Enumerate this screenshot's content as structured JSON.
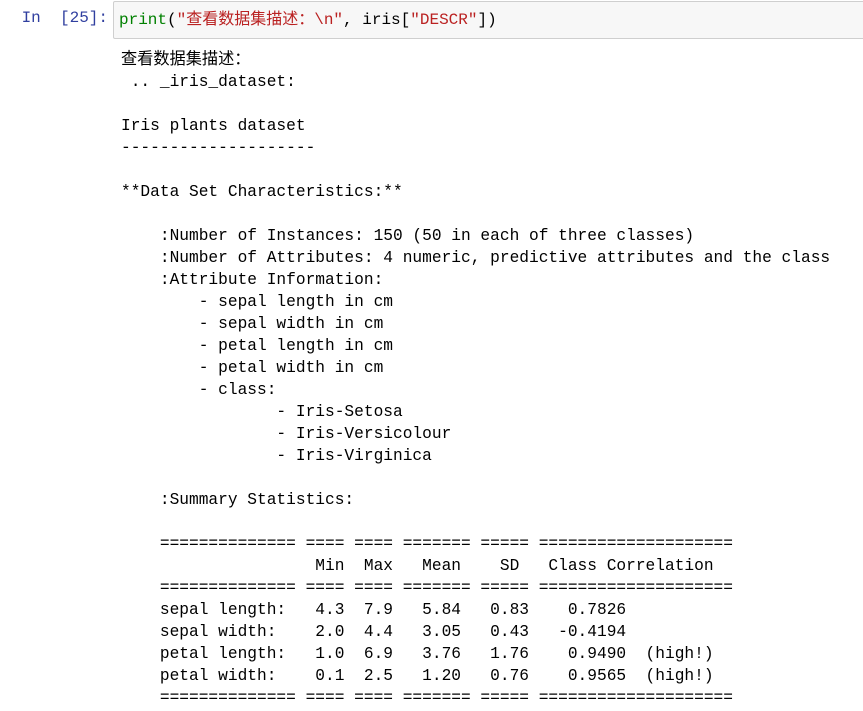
{
  "cell": {
    "prompt": "In  [25]:",
    "code": {
      "func": "print",
      "open": "(",
      "string": "\"查看数据集描述：\\n\"",
      "middle": ", iris[",
      "key": "\"DESCR\"",
      "close": "])"
    },
    "output_lines": [
      "查看数据集描述：",
      " .. _iris_dataset:",
      "",
      "Iris plants dataset",
      "--------------------",
      "",
      "**Data Set Characteristics:**",
      "",
      "    :Number of Instances: 150 (50 in each of three classes)",
      "    :Number of Attributes: 4 numeric, predictive attributes and the class",
      "    :Attribute Information:",
      "        - sepal length in cm",
      "        - sepal width in cm",
      "        - petal length in cm",
      "        - petal width in cm",
      "        - class:",
      "                - Iris-Setosa",
      "                - Iris-Versicolour",
      "                - Iris-Virginica",
      "",
      "    :Summary Statistics:",
      "",
      "    ============== ==== ==== ======= ===== ====================",
      "                    Min  Max   Mean    SD   Class Correlation",
      "    ============== ==== ==== ======= ===== ====================",
      "    sepal length:   4.3  7.9   5.84   0.83    0.7826",
      "    sepal width:    2.0  4.4   3.05   0.43   -0.4194",
      "    petal length:   1.0  6.9   3.76   1.76    0.9490  (high!)",
      "    petal width:    0.1  2.5   1.20   0.76    0.9565  (high!)",
      "    ============== ==== ==== ======= ===== ===================="
    ]
  }
}
